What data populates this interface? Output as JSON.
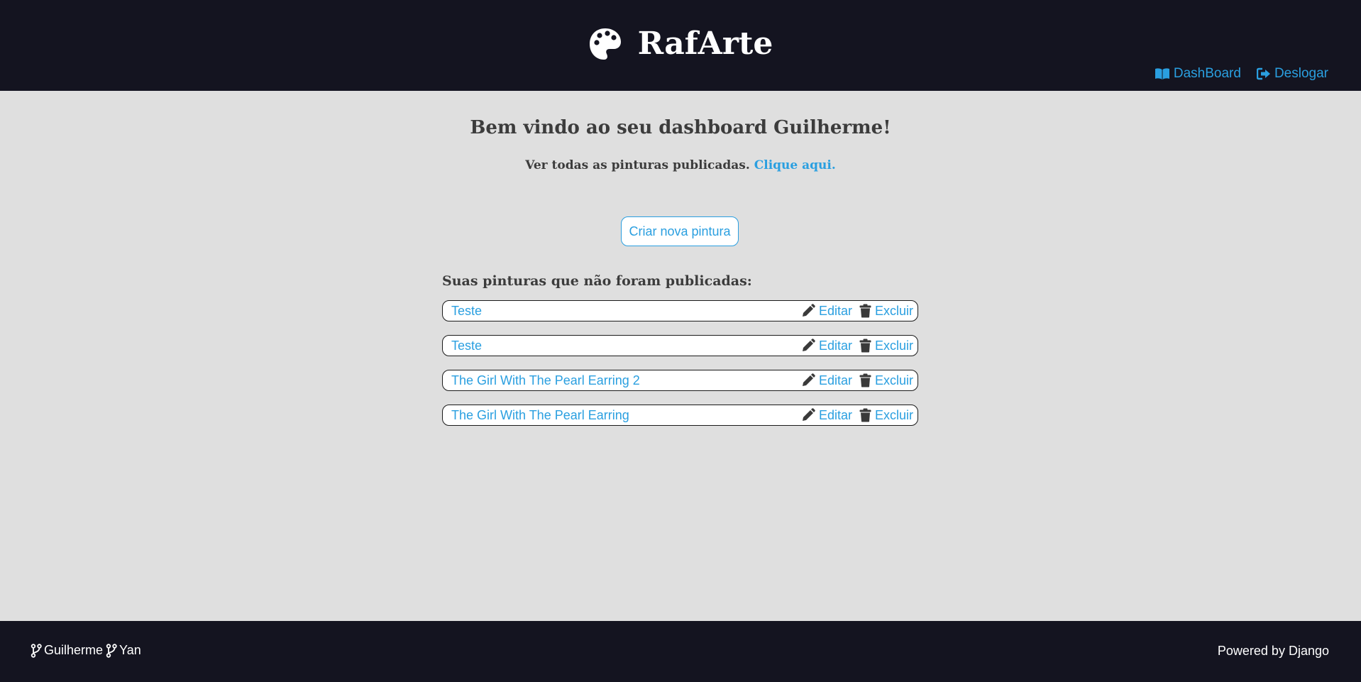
{
  "header": {
    "brand": "RafArte",
    "nav": {
      "dashboard": "DashBoard",
      "logout": "Deslogar"
    }
  },
  "main": {
    "welcome": "Bem vindo ao seu dashboard Guilherme!",
    "see_all_text": "Ver todas as pinturas publicadas.",
    "see_all_link": "Clique aqui.",
    "new_button": "Criar nova pintura",
    "list_title": "Suas pinturas que não foram publicadas:",
    "edit_label": "Editar",
    "delete_label": "Excluir",
    "paintings": [
      {
        "title": "Teste"
      },
      {
        "title": "Teste"
      },
      {
        "title": "The Girl With The Pearl Earring 2"
      },
      {
        "title": "The Girl With The Pearl Earring"
      }
    ]
  },
  "footer": {
    "authors": [
      "Guilherme",
      "Yan"
    ],
    "powered": "Powered by Django"
  },
  "colors": {
    "header_bg": "#141420",
    "page_bg": "#dfdfdf",
    "accent": "#2a9fe0",
    "text_dark": "#3c3c3c",
    "icon_dark": "#3a3a3a"
  },
  "icons": {
    "brand": "palette-icon",
    "dashboard": "book-open-icon",
    "logout": "sign-out-icon",
    "edit": "pencil-icon",
    "delete": "trash-icon",
    "author": "code-branch-icon"
  }
}
